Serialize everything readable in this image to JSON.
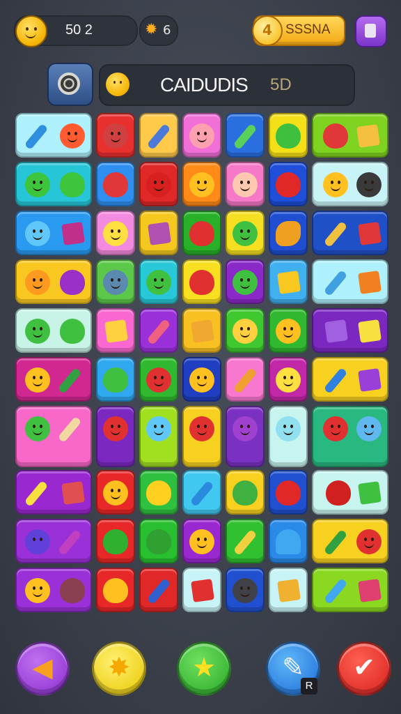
{
  "hud": {
    "coins": "50 2",
    "suns": "6",
    "gold_label": "SSSNA",
    "gold_coin_glyph": "4"
  },
  "banner": {
    "title": "CAIDUDIS",
    "value": "5D"
  },
  "badge": "R",
  "colors": {
    "background": "#3a3f4a",
    "panel": "#2c3038",
    "gold": "#f3a915"
  },
  "icons": [
    "face-coin-icon",
    "sun-icon",
    "gold-coin-icon",
    "gift-icon",
    "shell-icon",
    "arrow-icon",
    "star-badge-icon",
    "star-icon",
    "wand-icon",
    "check-icon"
  ]
}
